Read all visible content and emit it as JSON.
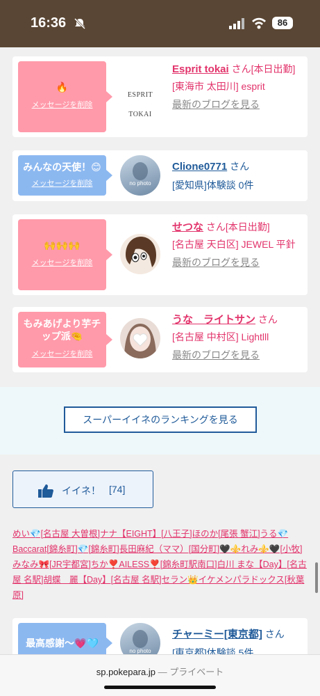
{
  "status": {
    "time": "16:36",
    "battery": "86"
  },
  "cards": [
    {
      "message": "🔥",
      "delete_label": "メッセージを削除",
      "logo_text": "ESPRIT TOKAI",
      "name": "Esprit tokai",
      "san": "さん",
      "tag": "[本日出勤]",
      "shop": "[東海市 太田川] esprit",
      "blog": "最新のブログを見る"
    },
    {
      "message": "みんなの天使！😊",
      "delete_label": "メッセージを削除",
      "avatar_text": "no photo",
      "name": "Clione0771",
      "san": "さん",
      "shop": "[愛知県]体験談 0件"
    },
    {
      "message": "🙌🙌🙌",
      "delete_label": "メッセージを削除",
      "name": "せつな",
      "san": "さん",
      "tag": "[本日出勤]",
      "shop": "[名古屋 天白区] JEWEL 平針",
      "blog": "最新のブログを見る"
    },
    {
      "message": "もみあげより芋チップ派🤏",
      "delete_label": "メッセージを削除",
      "name": "うな　ライトサン",
      "san": "さん",
      "shop": "[名古屋 中村区] Lightlll",
      "blog": "最新のブログを見る"
    },
    {
      "message": "最高感謝〜💗🩵",
      "avatar_text": "no photo",
      "name": "チャーミー[東京都]",
      "san": "さん",
      "shop": "[東京都]体験談 5件"
    }
  ],
  "ranking_button": "スーパーイイネのランキングを見る",
  "iine": {
    "label": "イイネ！",
    "count": "[74]"
  },
  "likers": [
    "めい💎[名古屋 大曽根]ナナ【EIGHT】[八王子]ほのか[尾張 蟹江]うる",
    "💎Baccarat[錦糸町]💎[錦糸町]長田麻紀（ママ）[国分町]🖤⚜️れみ⚜️🖤[小牧]みなみ🎀[JR宇都宮]ちか❣️AILESS❣️[錦糸町駅南口]白川 まな【Day】[名古屋 名駅]胡蝶　麗【Day】[名古屋 名駅]セラン👑イケメンパラドックス[秋葉原]"
  ],
  "url": {
    "domain": "sp.pokepara.jp",
    "suffix": " — プライベート"
  }
}
